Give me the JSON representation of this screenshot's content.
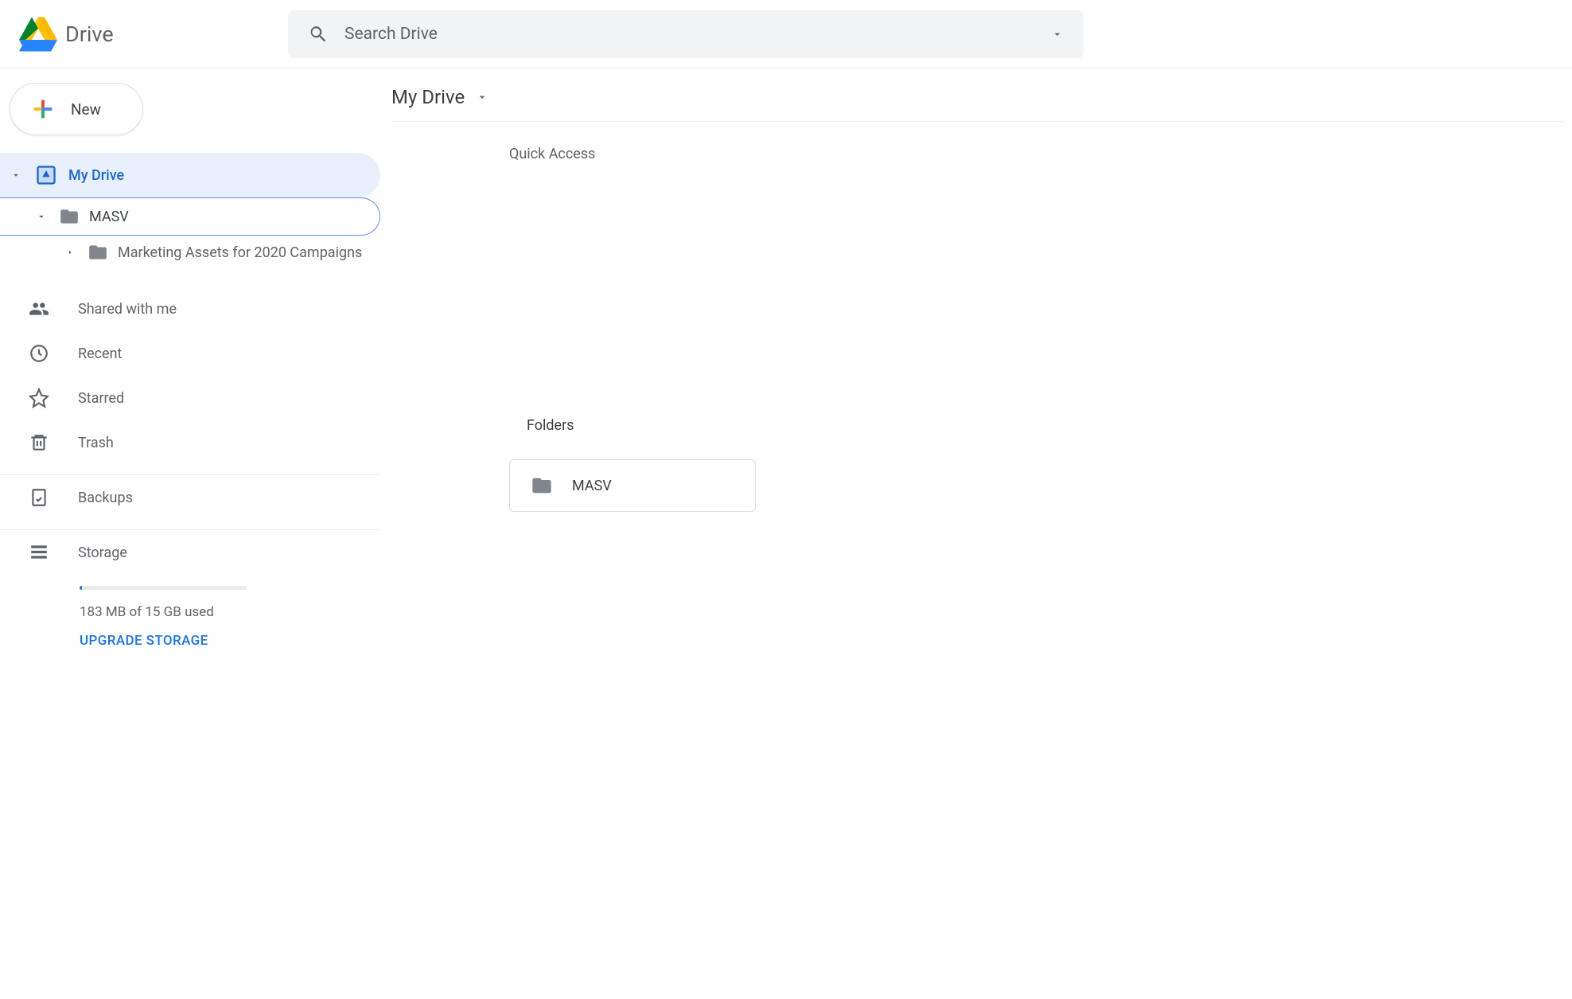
{
  "app": {
    "name": "Drive"
  },
  "search": {
    "placeholder": "Search Drive"
  },
  "new_button": {
    "label": "New"
  },
  "sidebar": {
    "my_drive": "My Drive",
    "tree": {
      "masv": "MASV",
      "marketing": "Marketing Assets for 2020 Campaigns"
    },
    "shared": "Shared with me",
    "recent": "Recent",
    "starred": "Starred",
    "trash": "Trash",
    "backups": "Backups",
    "storage_label": "Storage",
    "storage_text": "183 MB of 15 GB used",
    "upgrade": "UPGRADE STORAGE"
  },
  "main": {
    "breadcrumb": "My Drive",
    "quick_access": "Quick Access",
    "folders_label": "Folders",
    "folders": [
      {
        "name": "MASV"
      }
    ]
  }
}
